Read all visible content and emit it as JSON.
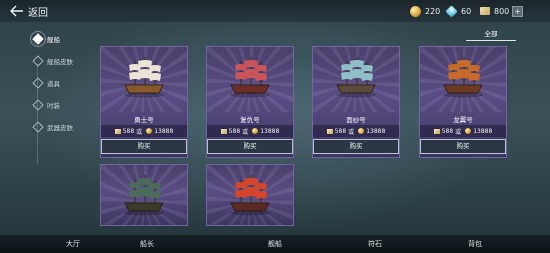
{
  "header": {
    "back_label": "返回",
    "resources": [
      {
        "icon": "gold-coin-icon",
        "value": "220"
      },
      {
        "icon": "diamond-icon",
        "value": "60"
      },
      {
        "icon": "ticket-icon",
        "value": "800"
      }
    ],
    "add_label": "+"
  },
  "sidebar": {
    "items": [
      {
        "label": "舰船",
        "active": true
      },
      {
        "label": "舰船皮肤",
        "active": false
      },
      {
        "label": "道具",
        "active": false
      },
      {
        "label": "时装",
        "active": false
      },
      {
        "label": "武器皮肤",
        "active": false
      }
    ]
  },
  "filter": {
    "label": "全部"
  },
  "ships": [
    {
      "name": "勇士号",
      "ticket_price": "588",
      "or_label": "或",
      "coin_price": "13888",
      "buy_label": "购买",
      "hull": "#8a5a2a",
      "sail": "#e9e4d6"
    },
    {
      "name": "复仇号",
      "ticket_price": "588",
      "or_label": "或",
      "coin_price": "13888",
      "buy_label": "购买",
      "hull": "#6b2f2a",
      "sail": "#c9555a"
    },
    {
      "name": "面纱号",
      "ticket_price": "588",
      "or_label": "或",
      "coin_price": "13888",
      "buy_label": "购买",
      "hull": "#5a4a3a",
      "sail": "#8fc0c8"
    },
    {
      "name": "龙翼号",
      "ticket_price": "588",
      "or_label": "或",
      "coin_price": "13888",
      "buy_label": "购买",
      "hull": "#6a3a22",
      "sail": "#c86a2a"
    },
    {
      "name": "",
      "hull": "#3a3a2a",
      "sail": "#4a6a5a"
    },
    {
      "name": "",
      "hull": "#5a2a22",
      "sail": "#d4452a"
    }
  ],
  "bottom_nav": [
    {
      "label": "大厅"
    },
    {
      "label": "船长"
    },
    {
      "label": "舰船"
    },
    {
      "label": "符石"
    },
    {
      "label": "背包"
    }
  ]
}
